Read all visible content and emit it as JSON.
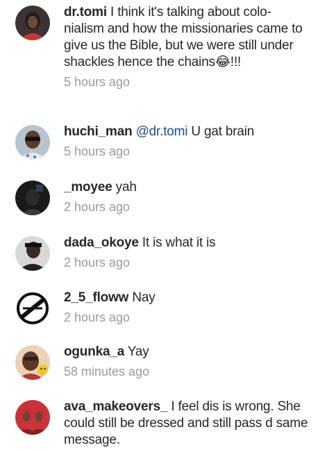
{
  "comments": [
    {
      "username": "dr.tomi",
      "mention": "",
      "text": "I think it's talking about colo-nialism and how the missionaries came to give us the Bible, but we were still under shackles hence the chains😂!!!",
      "time": "5 hours ago",
      "avatar": "avatar-woman-photo"
    },
    {
      "username": "huchi_man",
      "mention": "@dr.tomi",
      "text": "U gat brain",
      "time": "5 hours ago",
      "avatar": "avatar-man-sunglasses-photo"
    },
    {
      "username": "_moyee",
      "mention": "",
      "text": "yah",
      "time": "2 hours ago",
      "avatar": "avatar-dark-photo"
    },
    {
      "username": "dada_okoye",
      "mention": "",
      "text": "It is what it is",
      "time": "2 hours ago",
      "avatar": "avatar-man-photo"
    },
    {
      "username": "2_5_floww",
      "mention": "",
      "text": "Nay",
      "time": "2 hours ago",
      "avatar": "avatar-logo"
    },
    {
      "username": "ogunka_a",
      "mention": "",
      "text": "Yay",
      "time": "58 minutes ago",
      "avatar": "avatar-woman-emoji-photo"
    },
    {
      "username": "ava_makeovers_",
      "mention": "",
      "text": "I feel dis is wrong. She could still be dressed and still pass d same message.",
      "time": "",
      "avatar": "avatar-two-women-photo"
    }
  ]
}
